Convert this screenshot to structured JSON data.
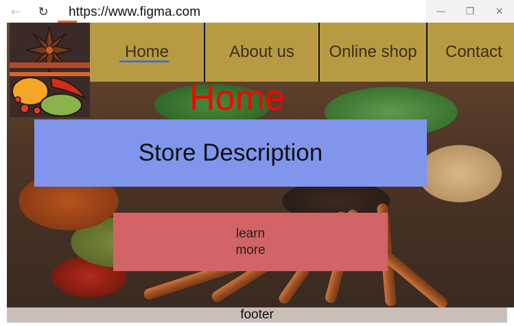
{
  "browser": {
    "url": "https://www.figma.com",
    "back_glyph": "←",
    "reload_glyph": "↻",
    "minimize_glyph": "—",
    "restore_glyph": "❐",
    "close_glyph": "✕"
  },
  "nav": {
    "items": [
      {
        "label": "Home"
      },
      {
        "label": "About us"
      },
      {
        "label": "Online shop"
      },
      {
        "label": "Contact"
      }
    ]
  },
  "hero": {
    "title": "Home",
    "description": "Store Description",
    "button_label": "learn more"
  },
  "footer": {
    "label": "footer"
  },
  "colors": {
    "nav_bg": "#b89a42",
    "desc_bg": "#7f96ec",
    "button_bg": "#d26466",
    "title": "#ff0000",
    "footer_bg": "#c9bfb8"
  }
}
